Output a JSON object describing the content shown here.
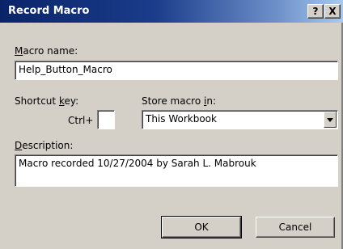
{
  "window": {
    "title": "Record Macro",
    "help_label": "?",
    "close_label": "X"
  },
  "macro_name": {
    "label_underlined": "M",
    "label_rest": "acro name:",
    "value": "Help_Button_Macro"
  },
  "shortcut": {
    "label_pre": "Shortcut ",
    "label_underlined": "k",
    "label_post": "ey:",
    "prefix": "Ctrl+",
    "value": ""
  },
  "store": {
    "label_pre": "Store macro ",
    "label_underlined": "i",
    "label_post": "n:",
    "value": "This Workbook",
    "arrow_icon": "chevron-down-icon"
  },
  "description": {
    "label_underlined": "D",
    "label_rest": "escription:",
    "value": "Macro recorded 10/27/2004 by Sarah L. Mabrouk"
  },
  "buttons": {
    "ok": "OK",
    "cancel": "Cancel"
  },
  "colors": {
    "title_start": "#0a246a",
    "title_end": "#a6caf0",
    "face": "#d4d0c8"
  }
}
